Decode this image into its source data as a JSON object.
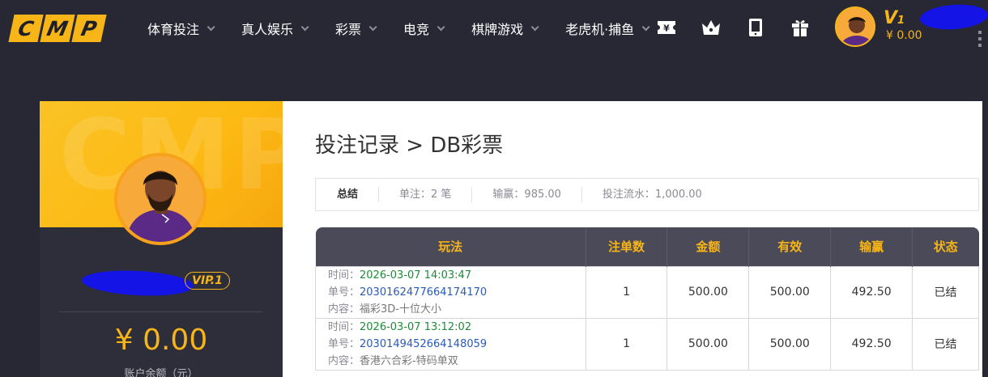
{
  "logo": [
    "C",
    "M",
    "P"
  ],
  "nav": [
    {
      "label": "体育投注"
    },
    {
      "label": "真人娱乐"
    },
    {
      "label": "彩票"
    },
    {
      "label": "电竞"
    },
    {
      "label": "棋牌游戏"
    },
    {
      "label": "老虎机·捕鱼"
    }
  ],
  "nav_icons": [
    "ticket-icon",
    "crown-icon",
    "tablet-icon",
    "gift-icon"
  ],
  "user": {
    "level_prefix": "V",
    "level_num": "1",
    "top_balance": "¥ 0.00",
    "vip_badge": "VIP.1",
    "balance": "¥ 0.00",
    "balance_label": "账户余额（元）",
    "watermark": "CMP"
  },
  "page": {
    "title": "投注记录 > DB彩票"
  },
  "summary": {
    "title": "总结",
    "bets": "单注：2 笔",
    "winloss": "输赢：985.00",
    "turnover": "投注流水：1,000.00"
  },
  "table": {
    "headers": [
      "玩法",
      "注单数",
      "金额",
      "有效",
      "输赢",
      "状态"
    ],
    "labels": {
      "time": "时间：",
      "order": "单号：",
      "content": "内容："
    },
    "rows": [
      {
        "time": "2026-03-07 14:03:47",
        "order": "2030162477664174170",
        "content": "福彩3D-十位大小",
        "count": "1",
        "amount": "500.00",
        "valid": "500.00",
        "winloss": "492.50",
        "status": "已结"
      },
      {
        "time": "2026-03-07 13:12:02",
        "order": "2030149452664148059",
        "content": "香港六合彩-特码单双",
        "count": "1",
        "amount": "500.00",
        "valid": "500.00",
        "winloss": "492.50",
        "status": "已结"
      }
    ]
  },
  "colors": {
    "accent": "#f7b518",
    "header_bg": "#272834",
    "win": "#1f8a3a",
    "order": "#2a5ab5"
  }
}
